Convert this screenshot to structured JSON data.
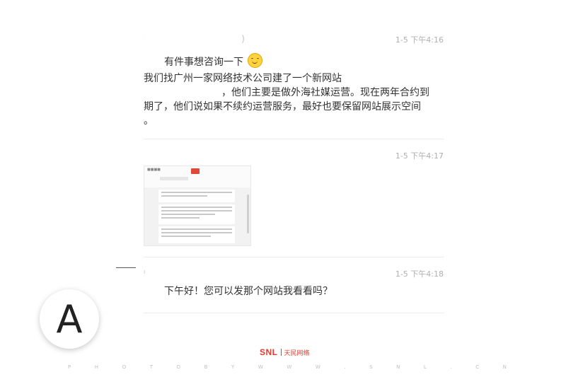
{
  "messages": [
    {
      "timestamp": "1-5 下午4:16",
      "fragment": ")",
      "greeting": "有件事想咨询一下",
      "body": {
        "line1": "我们找广州一家网络技术公司建了一个新网站",
        "line2": "，他们主要是做外海社媒运营。现在两年合约到",
        "line3": "期了，他们说如果不续约运营服务，最好也要保留网站展示空间",
        "line4": "。"
      },
      "emoji": "smile-emoji"
    },
    {
      "timestamp": "1-5 下午4:17",
      "attachment": "screenshot-image"
    },
    {
      "timestamp": "1-5 下午4:18",
      "text": "下午好！您可以发那个网站我看看吗？"
    }
  ],
  "avatar": {
    "letter": "A"
  },
  "logo": {
    "brand": "SNL",
    "cn": "天民网络"
  },
  "watermark": [
    "P",
    "H",
    "O",
    "T",
    "O",
    "B",
    "Y",
    "W",
    "W",
    "W",
    ".",
    "S",
    "N",
    "L",
    ".",
    "C",
    "N"
  ],
  "colors": {
    "brand_red": "#e23b2d",
    "timestamp": "#b0b0b0",
    "text": "#333333"
  }
}
